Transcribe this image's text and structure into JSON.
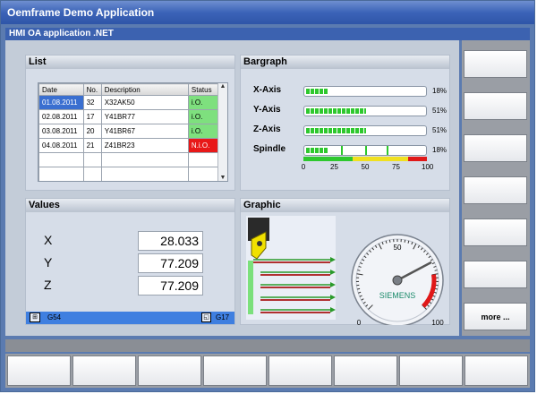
{
  "window": {
    "title": "Oemframe Demo Application"
  },
  "app": {
    "header": "HMI OA application .NET"
  },
  "list": {
    "title": "List",
    "columns": [
      "Date",
      "No.",
      "Description",
      "Status"
    ],
    "rows": [
      {
        "date": "01.08.2011",
        "no": "32",
        "desc": "X32AK50",
        "status": "i.O."
      },
      {
        "date": "02.08.2011",
        "no": "17",
        "desc": "Y41BR77",
        "status": "i.O."
      },
      {
        "date": "03.08.2011",
        "no": "20",
        "desc": "Y41BR67",
        "status": "i.O."
      },
      {
        "date": "04.08.2011",
        "no": "21",
        "desc": "Z41BR23",
        "status": "N.i.O."
      }
    ],
    "status_colors": {
      "ok": "#7ee07e",
      "nok": "#e81818"
    }
  },
  "bargraph": {
    "title": "Bargraph",
    "bars": [
      {
        "label": "X-Axis",
        "percent": 18,
        "percent_text": "18%"
      },
      {
        "label": "Y-Axis",
        "percent": 51,
        "percent_text": "51%"
      },
      {
        "label": "Z-Axis",
        "percent": 51,
        "percent_text": "51%"
      },
      {
        "label": "Spindle",
        "percent": 18,
        "percent_text": "18%"
      }
    ],
    "scale": [
      "0",
      "25",
      "50",
      "75",
      "100"
    ],
    "spindle_zones": [
      {
        "from": 0,
        "to": 40,
        "color": "#2ec82e"
      },
      {
        "from": 40,
        "to": 85,
        "color": "#f0e020"
      },
      {
        "from": 85,
        "to": 100,
        "color": "#e01818"
      }
    ]
  },
  "values": {
    "title": "Values",
    "items": [
      {
        "axis": "X",
        "value": "28.033"
      },
      {
        "axis": "Y",
        "value": "77.209"
      },
      {
        "axis": "Z",
        "value": "77.209"
      }
    ],
    "footer_left": "G54",
    "footer_right": "G17"
  },
  "graphic": {
    "title": "Graphic",
    "gauge": {
      "min": "0",
      "mid": "50",
      "max": "100",
      "value": 73,
      "brand": "SIEMENS"
    }
  },
  "softkeys": {
    "right": [
      "",
      "",
      "",
      "",
      "",
      "",
      "more ..."
    ],
    "bottom": [
      "",
      "",
      "",
      "",
      "",
      "",
      "",
      ""
    ]
  }
}
